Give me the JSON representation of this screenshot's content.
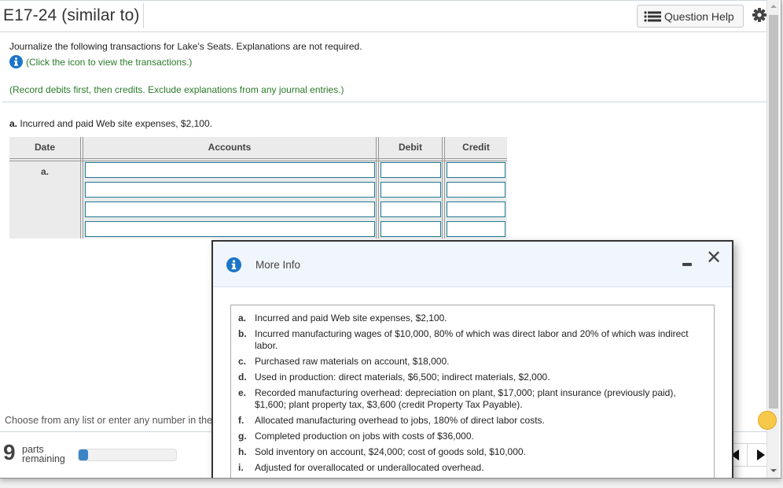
{
  "header": {
    "title": "E17-24 (similar to)",
    "question_help_label": "Question Help"
  },
  "instructions": {
    "main": "Journalize the following transactions for Lake's Seats. Explanations are not required.",
    "info_link": "(Click the icon to view the transactions.)",
    "note": "(Record debits first, then credits. Exclude explanations from any journal entries.)"
  },
  "part": {
    "letter": "a.",
    "question": "Incurred and paid Web site expenses, $2,100."
  },
  "journal_table": {
    "columns": [
      "Date",
      "Accounts",
      "Debit",
      "Credit"
    ],
    "date_label": "a.",
    "rows": [
      {
        "account": "",
        "debit": "",
        "credit": ""
      },
      {
        "account": "",
        "debit": "",
        "credit": ""
      },
      {
        "account": "",
        "debit": "",
        "credit": ""
      },
      {
        "account": "",
        "debit": "",
        "credit": ""
      }
    ]
  },
  "footer": {
    "hint": "Choose from any list or enter any number in the input fields and then continue to the next question.",
    "parts_remaining_count": "9",
    "parts_label_line1": "parts",
    "parts_label_line2": "remaining",
    "progress_fraction": 0.1
  },
  "modal": {
    "title": "More Info",
    "transactions": [
      {
        "letter": "a.",
        "text": "Incurred and paid Web site expenses, $2,100."
      },
      {
        "letter": "b.",
        "text": "Incurred manufacturing wages of $10,000, 80% of which was direct labor and 20% of which was indirect labor."
      },
      {
        "letter": "c.",
        "text": "Purchased raw materials on account, $18,000."
      },
      {
        "letter": "d.",
        "text": "Used in production: direct materials, $6,500; indirect materials, $2,000."
      },
      {
        "letter": "e.",
        "text": "Recorded manufacturing overhead: depreciation on plant, $17,000; plant insurance (previously paid), $1,600; plant property tax, $3,600 (credit Property Tax Payable)."
      },
      {
        "letter": "f.",
        "text": "Allocated manufacturing overhead to jobs, 180% of direct labor costs."
      },
      {
        "letter": "g.",
        "text": "Completed production on jobs with costs of $36,000."
      },
      {
        "letter": "h.",
        "text": "Sold inventory on account, $24,000; cost of goods sold, $10,000."
      },
      {
        "letter": "i.",
        "text": "Adjusted for overallocated or underallocated overhead."
      }
    ]
  },
  "colors": {
    "info_blue": "#1a75c9",
    "green_text": "#2a7a2a",
    "input_border": "#1e7a95",
    "progress_fill": "#3d86c6"
  }
}
